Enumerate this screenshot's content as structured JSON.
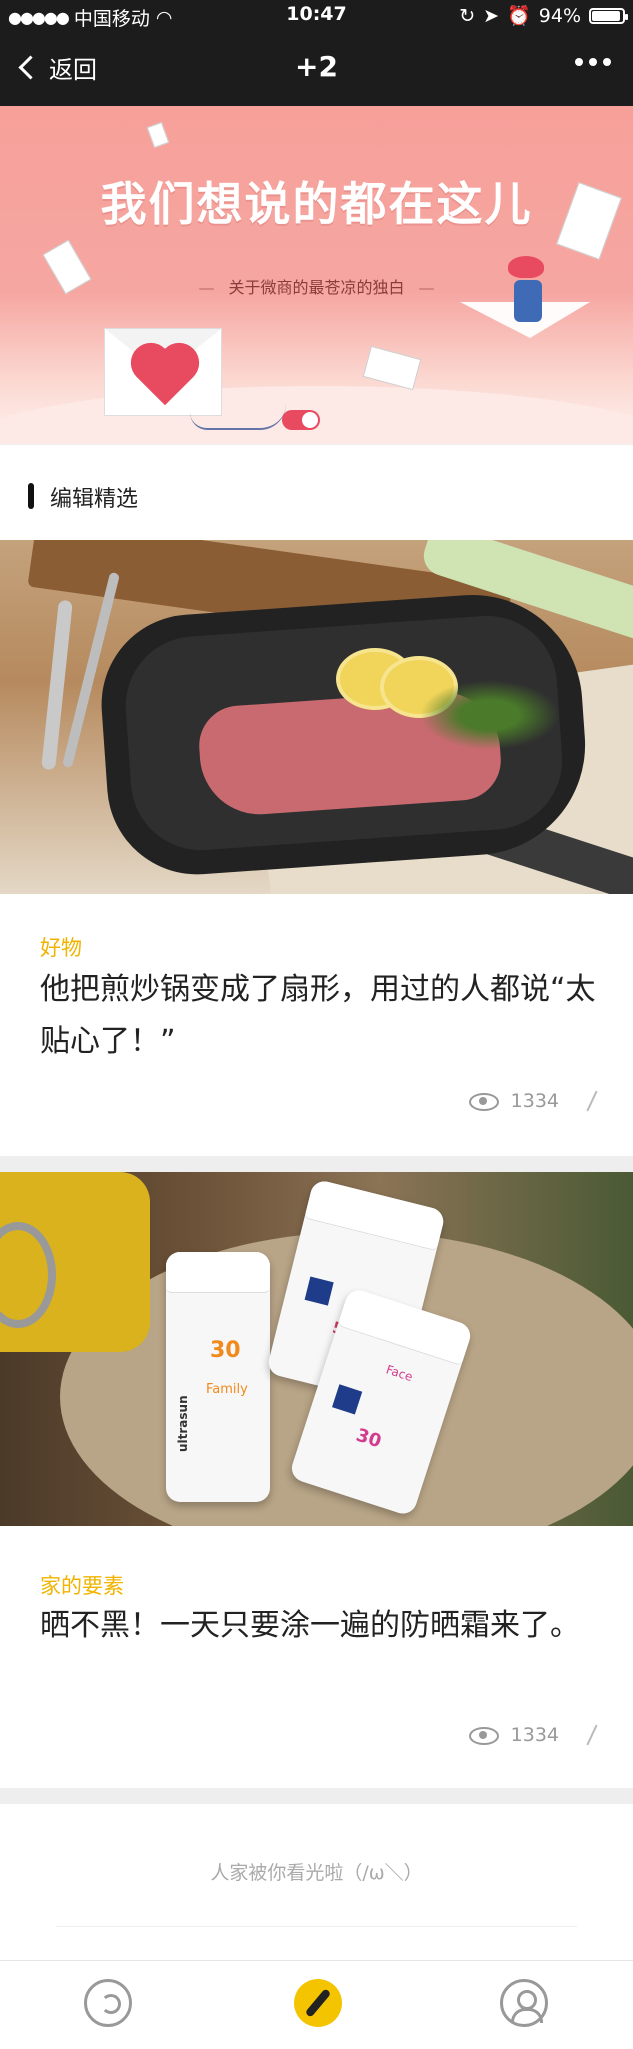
{
  "status": {
    "signal_dots": "●●●●●",
    "carrier": "中国移动",
    "time": "10:47",
    "battery_percent": "94%",
    "battery_level": 0.94
  },
  "nav": {
    "back_label": "返回",
    "title": "+2"
  },
  "banner": {
    "headline": "我们想说的都在这儿",
    "subtitle": "关于微商的最苍凉的独白"
  },
  "section": {
    "title": "编辑精选"
  },
  "articles": [
    {
      "category": "好物",
      "title": "他把煎炒锅变成了扇形，用过的人都说“太贴心了！”",
      "views": "1334"
    },
    {
      "category": "家的要素",
      "title": "晒不黑！一天只要涂一遍的防晒霜来了。",
      "views": "1334"
    }
  ],
  "bottle_labels": {
    "brand": "ultrasun",
    "spf_family": "30",
    "family_label": "Family",
    "spf_face": "30",
    "face_label": "Face",
    "spf_back": "50"
  },
  "end_text": "人家被你看光啦（/ω＼）",
  "colors": {
    "accent_yellow": "#f0b400",
    "nav_bg": "#1c1c1c",
    "banner_pink": "#f7a09a"
  },
  "tabs": [
    "messages-icon",
    "discover-icon",
    "profile-icon"
  ]
}
